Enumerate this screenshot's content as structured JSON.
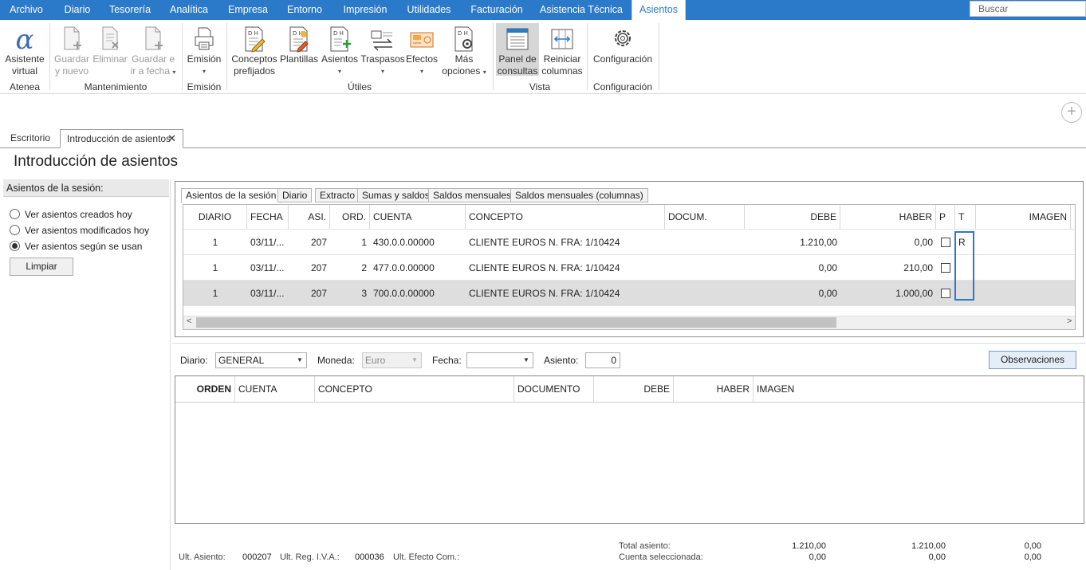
{
  "menu": {
    "items": [
      "Archivo",
      "Diario",
      "Tesorería",
      "Analítica",
      "Empresa",
      "Entorno",
      "Impresión",
      "Utilidades",
      "Facturación",
      "Asistencia Técnica",
      "Asientos"
    ],
    "search_placeholder": "Buscar",
    "accent_color": "#2b79c9"
  },
  "ribbon": {
    "asistente": [
      "Asistente",
      "virtual"
    ],
    "guardar_nuevo": [
      "Guardar",
      "y nuevo"
    ],
    "eliminar": "Eliminar",
    "guardar_fecha": [
      "Guardar e",
      "ir a fecha"
    ],
    "emision": "Emisión",
    "conceptos": [
      "Conceptos",
      "prefijados"
    ],
    "plantillas": "Plantillas",
    "asientos": "Asientos",
    "traspasos": "Traspasos",
    "efectos": "Efectos",
    "mas": [
      "Más",
      "opciones"
    ],
    "panel": [
      "Panel de",
      "consultas"
    ],
    "reiniciar": [
      "Reiniciar",
      "columnas"
    ],
    "configuracion": "Configuración",
    "groups": {
      "atenea": "Atenea",
      "mantenimiento": "Mantenimiento",
      "emision": "Emisión",
      "utiles": "Útiles",
      "vista": "Vista",
      "configuracion": "Configuración"
    }
  },
  "doc_tabs": {
    "escritorio": "Escritorio",
    "active": "Introducción de asientos"
  },
  "page_title": "Introducción de asientos",
  "session": {
    "header": "Asientos de la sesión:",
    "options": [
      "Ver asientos creados hoy",
      "Ver asientos modificados hoy",
      "Ver asientos según se usan"
    ],
    "selected_index": 2,
    "clear_label": "Limpiar"
  },
  "inner_tabs": [
    "Asientos de la sesión",
    "Diario",
    "Extracto",
    "Sumas y saldos",
    "Saldos mensuales",
    "Saldos mensuales (columnas)"
  ],
  "grid": {
    "columns": [
      "DIARIO",
      "FECHA",
      "ASI.",
      "ORD.",
      "CUENTA",
      "CONCEPTO",
      "DOCUM.",
      "DEBE",
      "HABER",
      "P",
      "T",
      "IMAGEN"
    ],
    "rows": [
      {
        "diario": "1",
        "fecha": "03/11/...",
        "asi": "207",
        "ord": "1",
        "cuenta": "430.0.0.00000",
        "concepto": "CLIENTE EUROS N. FRA:  1/10424",
        "docum": "",
        "debe": "1.210,00",
        "haber": "0,00",
        "p": false,
        "t": "R",
        "imagen": ""
      },
      {
        "diario": "1",
        "fecha": "03/11/...",
        "asi": "207",
        "ord": "2",
        "cuenta": "477.0.0.00000",
        "concepto": "CLIENTE EUROS N. FRA:  1/10424",
        "docum": "",
        "debe": "0,00",
        "haber": "210,00",
        "p": false,
        "t": "",
        "imagen": ""
      },
      {
        "diario": "1",
        "fecha": "03/11/...",
        "asi": "207",
        "ord": "3",
        "cuenta": "700.0.0.00000",
        "concepto": "CLIENTE EUROS N. FRA:  1/10424",
        "docum": "",
        "debe": "0,00",
        "haber": "1.000,00",
        "p": false,
        "t": "",
        "imagen": ""
      }
    ],
    "selected_row": 2
  },
  "form": {
    "diario_label": "Diario:",
    "diario_value": "GENERAL",
    "moneda_label": "Moneda:",
    "moneda_value": "Euro",
    "fecha_label": "Fecha:",
    "fecha_value": "",
    "asiento_label": "Asiento:",
    "asiento_value": "0",
    "obs_label": "Observaciones"
  },
  "lower_grid": {
    "columns": [
      "ORDEN",
      "CUENTA",
      "CONCEPTO",
      "DOCUMENTO",
      "DEBE",
      "HABER",
      "IMAGEN"
    ]
  },
  "footer": {
    "ult_asiento_label": "Ult. Asiento:",
    "ult_asiento": "000207",
    "ult_reg_label": "Ult. Reg. I.V.A.:",
    "ult_reg": "000036",
    "ult_efecto_label": "Ult. Efecto Com.:",
    "total_label": "Total asiento:",
    "cuenta_label": "Cuenta seleccionada:",
    "total_values": [
      "1.210,00",
      "1.210,00",
      "0,00"
    ],
    "cuenta_values": [
      "0,00",
      "0,00",
      "0,00"
    ]
  }
}
